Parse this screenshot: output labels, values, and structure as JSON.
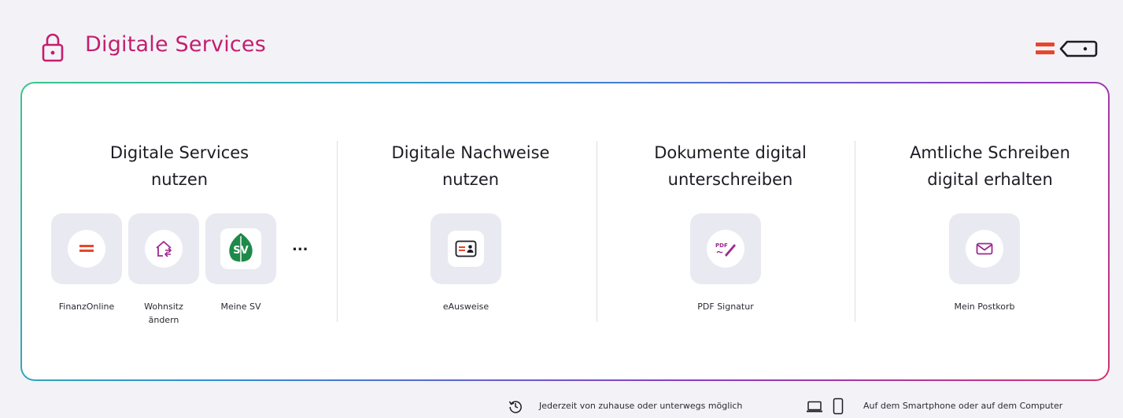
{
  "header": {
    "title": "Digitale Services",
    "lock_icon": "lock-icon",
    "logo": "oesterreich-gv-logo",
    "accent_color": "#c41e6f"
  },
  "sections": [
    {
      "title": "Digitale Services\nnutzen",
      "tiles": [
        {
          "label": "FinanzOnline",
          "icon": "finanzonline-icon"
        },
        {
          "label": "Wohnsitz\nändern",
          "icon": "house-arrows-icon"
        },
        {
          "label": "Meine SV",
          "icon": "sv-leaf-icon",
          "badge_text": "SV"
        }
      ],
      "more_label": "..."
    },
    {
      "title": "Digitale Nachweise\nnutzen",
      "tiles": [
        {
          "label": "eAusweise",
          "icon": "id-card-icon"
        }
      ]
    },
    {
      "title": "Dokumente digital\nunterschreiben",
      "tiles": [
        {
          "label": "PDF Signatur",
          "icon": "pdf-signature-icon",
          "badge_text": "PDF"
        }
      ]
    },
    {
      "title": "Amtliche Schreiben\ndigital erhalten",
      "tiles": [
        {
          "label": "Mein Postkorb",
          "icon": "envelope-icon"
        }
      ]
    }
  ],
  "footer": {
    "availability_text": "Jederzeit von zuhause oder unterwegs möglich",
    "availability_icon": "clock-history-icon",
    "devices_text": "Auf dem Smartphone oder auf dem Computer",
    "devices_icons": [
      "laptop-icon",
      "smartphone-icon"
    ]
  }
}
